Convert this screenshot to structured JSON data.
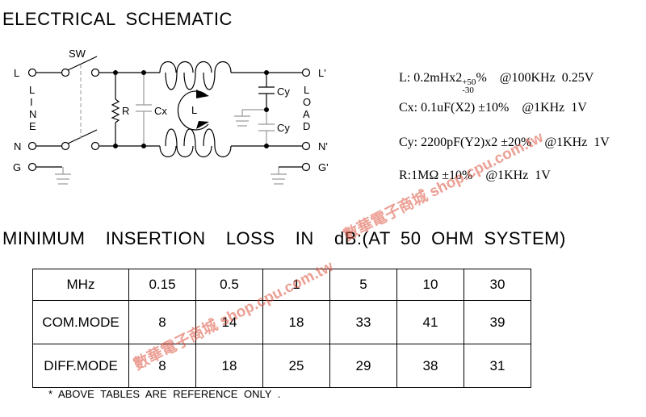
{
  "title": "ELECTRICAL  SCHEMATIC",
  "schematic": {
    "L": "L",
    "N": "N",
    "G": "G",
    "Lp": "L'",
    "Np": "N'",
    "Gp": "G'",
    "SW": "SW",
    "R": "R",
    "Cx": "Cx",
    "Lind": "L",
    "Cy1": "Cy",
    "Cy2": "Cy",
    "line": [
      "L",
      "I",
      "N",
      "E"
    ],
    "load": [
      "L",
      "O",
      "A",
      "D"
    ]
  },
  "specs": {
    "L": {
      "main": "L: 0.2mHx2",
      "plus": "+50",
      "minus": "-30",
      "rest": "%    @100KHz  0.25V"
    },
    "Cx": "Cx: 0.1uF(X2) ±10%    @1KHz  1V",
    "Cy": "Cy: 2200pF(Y2)x2 ±20%    @1KHz  1V",
    "R": "R:1MΩ ±10%    @1KHz  1V"
  },
  "loss_title": "MINIMUM  INSERTION  LOSS  IN  dB:(AT 50 OHM SYSTEM)",
  "table": {
    "header": [
      "MHz",
      "0.15",
      "0.5",
      "1",
      "5",
      "10",
      "30"
    ],
    "rows": [
      [
        "COM.MODE",
        "8",
        "14",
        "18",
        "33",
        "41",
        "39"
      ],
      [
        "DIFF.MODE",
        "8",
        "18",
        "25",
        "29",
        "38",
        "31"
      ]
    ]
  },
  "note": "* ABOVE  TABLES  ARE  REFERENCE  ONLY .",
  "watermark": [
    "數華電子商城 shop.cpu.com.tw",
    "數華電子商城 shop.cpu.com.tw"
  ]
}
